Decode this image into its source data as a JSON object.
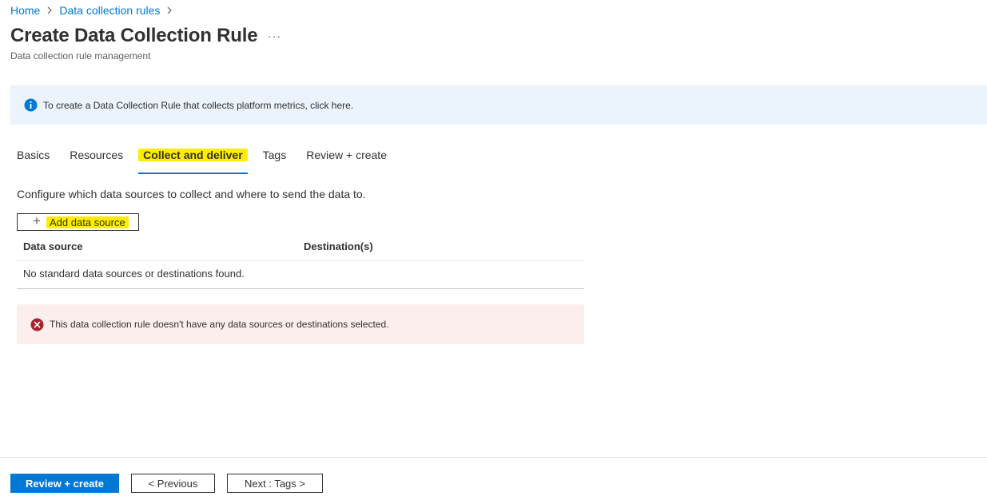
{
  "breadcrumb": {
    "items": [
      "Home",
      "Data collection rules"
    ]
  },
  "header": {
    "title": "Create Data Collection Rule",
    "more": "···",
    "subtitle": "Data collection rule management"
  },
  "info_banner": {
    "text": "To create a Data Collection Rule that collects platform metrics, click here."
  },
  "tabs": [
    {
      "label": "Basics",
      "active": false
    },
    {
      "label": "Resources",
      "active": false
    },
    {
      "label": "Collect and deliver",
      "active": true
    },
    {
      "label": "Tags",
      "active": false
    },
    {
      "label": "Review + create",
      "active": false
    }
  ],
  "main": {
    "description": "Configure which data sources to collect and where to send the data to.",
    "add_button": "Add data source",
    "table": {
      "columns": [
        "Data source",
        "Destination(s)"
      ],
      "empty_message": "No standard data sources or destinations found."
    },
    "error": "This data collection rule doesn't have any data sources or destinations selected."
  },
  "footer": {
    "review_create": "Review + create",
    "previous": "< Previous",
    "next": "Next : Tags >"
  },
  "colors": {
    "accent": "#0078d4",
    "highlight": "#ffec00",
    "info_bg": "#ebf3fc",
    "error_bg": "#fdeeee",
    "error_icon": "#a4262c"
  },
  "icons": {
    "info": "info-icon",
    "error": "error-circle-icon",
    "plus": "plus-icon",
    "chevron": "chevron-right-icon"
  }
}
